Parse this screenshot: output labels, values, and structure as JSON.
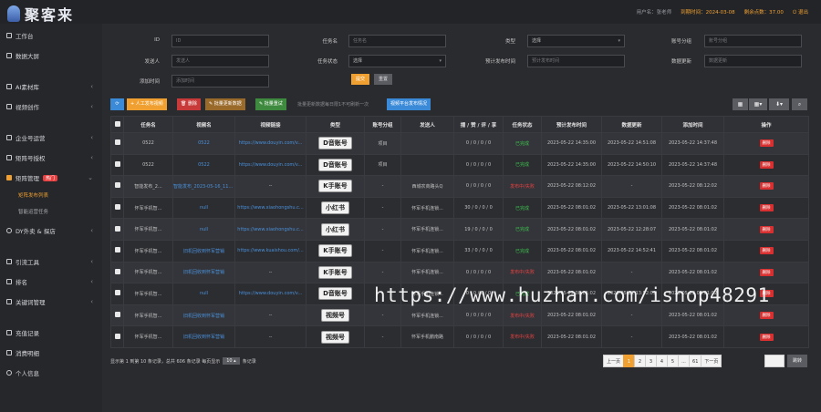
{
  "header": {
    "logo_text": "聚客来",
    "user": "用户名：张老师",
    "expire": "到期时间：2024-03-08",
    "points": "剩余点数：37.00",
    "logout": "退出"
  },
  "sidebar": {
    "items": [
      {
        "label": "工作台",
        "chev": ""
      },
      {
        "label": "数据大屏",
        "chev": ""
      },
      {
        "label": "AI素材库",
        "chev": "‹"
      },
      {
        "label": "视频创作",
        "chev": "‹"
      },
      {
        "label": "企业号运营",
        "chev": "‹"
      },
      {
        "label": "矩阵号授权",
        "chev": "‹"
      },
      {
        "label": "矩阵管理",
        "chev": "⌄",
        "badge": "热门"
      },
      {
        "label": "DY外卖 & 探店",
        "chev": "‹"
      },
      {
        "label": "引流工具",
        "chev": "‹"
      },
      {
        "label": "排名",
        "chev": "‹"
      },
      {
        "label": "关键词管理",
        "chev": "‹"
      },
      {
        "label": "充值记录",
        "chev": ""
      },
      {
        "label": "消费明细",
        "chev": ""
      },
      {
        "label": "个人信息",
        "chev": ""
      }
    ],
    "subitems": [
      "矩阵发布列表",
      "智能运营任务"
    ]
  },
  "filters": {
    "id_label": "ID",
    "id_ph": "ID",
    "taskname_label": "任务名",
    "taskname_ph": "任务名",
    "type_label": "类型",
    "type_value": "选择",
    "account_group_label": "账号分组",
    "account_group_ph": "账号分组",
    "publisher_label": "发送人",
    "publisher_ph": "发送人",
    "task_status_label": "任务状态",
    "task_status_value": "选择",
    "plan_time_label": "预计发布时间",
    "plan_time_ph": "预计发布时间",
    "data_update_label": "数据更新",
    "data_update_ph": "数据更新",
    "add_time_label": "添加时间",
    "add_time_ph": "添加时间",
    "submit": "提交",
    "reset": "重置"
  },
  "toolbar": {
    "refresh": "⟳",
    "manual_publish": "+ 人工发布视频",
    "delete": "删除",
    "batch_update": "批量更新数据",
    "batch_edit": "批量重试",
    "note": "批量更新数据每日限1不可刷新一次",
    "platform_btn": "视频平台发布情况"
  },
  "table": {
    "headers": [
      "",
      "任务名",
      "视频名",
      "视频链接",
      "类型",
      "账号分组",
      "发送人",
      "播 / 赞 / 评 / 享",
      "任务状态",
      "预计发布时间",
      "数据更新",
      "添加时间",
      "操作"
    ],
    "rows": [
      {
        "task": "0522",
        "video": "0522",
        "url": "https://www.douyin.com/v...",
        "type": "D音账号",
        "group": "项目",
        "sender": "",
        "stats": "0 / 0 / 0 / 0",
        "status": "已完成",
        "status_color": "green",
        "plan": "2023-05-22 14:35:00",
        "update": "2023-05-22 14:51:08",
        "added": "2023-05-22 14:37:48",
        "op": "删除"
      },
      {
        "task": "0522",
        "video": "0522",
        "url": "https://www.douyin.com/v...",
        "type": "D音账号",
        "group": "项目",
        "sender": "",
        "stats": "0 / 0 / 0 / 0",
        "status": "已完成",
        "status_color": "green",
        "plan": "2023-05-22 14:35:00",
        "update": "2023-05-22 14:50:10",
        "added": "2023-05-22 14:37:48",
        "op": "删除"
      },
      {
        "task": "智能发布_2...",
        "video": "智能发布_2023-05-16_11:20",
        "url": "--",
        "type": "K手账号",
        "group": "-",
        "sender": "西城农商路头Q",
        "stats": "0 / 0 / 0 / 0",
        "status": "发布中/失败",
        "status_color": "red",
        "plan": "2023-05-22 08:12:02",
        "update": "-",
        "added": "2023-05-22 08:12:02",
        "op": "删除"
      },
      {
        "task": "怀军手机智...",
        "video": "null",
        "url": "https://www.xiaohongshu.c...",
        "type": "小红书",
        "group": "-",
        "sender": "怀军手机连锁...",
        "stats": "30 / 0 / 0 / 0",
        "status": "已完成",
        "status_color": "green",
        "plan": "2023-05-22 08:01:02",
        "update": "2023-05-22 13:01:08",
        "added": "2023-05-22 08:01:02",
        "op": "删除"
      },
      {
        "task": "怀军手机智...",
        "video": "null",
        "url": "https://www.xiaohongshu.c...",
        "type": "小红书",
        "group": "-",
        "sender": "怀军手机连锁...",
        "stats": "19 / 0 / 0 / 0",
        "status": "已完成",
        "status_color": "green",
        "plan": "2023-05-22 08:01:02",
        "update": "2023-05-22 12:28:07",
        "added": "2023-05-22 08:01:02",
        "op": "删除"
      },
      {
        "task": "怀军手机智...",
        "video": "旧机回收到怀军营销",
        "url": "https://www.kuaishou.com/...",
        "type": "K手账号",
        "group": "-",
        "sender": "怀军手机连锁...",
        "stats": "33 / 0 / 0 / 0",
        "status": "已完成",
        "status_color": "green",
        "plan": "2023-05-22 08:01:02",
        "update": "2023-05-22 14:52:41",
        "added": "2023-05-22 08:01:02",
        "op": "删除"
      },
      {
        "task": "怀军手机智...",
        "video": "旧机回收到怀军营销",
        "url": "--",
        "type": "K手账号",
        "group": "-",
        "sender": "怀军手机连锁...",
        "stats": "0 / 0 / 0 / 0",
        "status": "发布中/失败",
        "status_color": "red",
        "plan": "2023-05-22 08:01:02",
        "update": "-",
        "added": "2023-05-22 08:01:02",
        "op": "删除"
      },
      {
        "task": "怀军手机智...",
        "video": "null",
        "url": "https://www.douyin.com/v...",
        "type": "D音账号",
        "group": "-",
        "sender": "怀军手机连锁...",
        "stats": "0 / 0 / 0 / 0",
        "status": "已完成",
        "status_color": "green",
        "plan": "2023-05-22 08:01:02",
        "update": "2023-05-22 13:52:09",
        "added": "2023-05-22 08:01:02",
        "op": "删除"
      },
      {
        "task": "怀军手机智...",
        "video": "旧机回收到怀军营销",
        "url": "--",
        "type": "视频号",
        "group": "-",
        "sender": "怀军手机连锁...",
        "stats": "0 / 0 / 0 / 0",
        "status": "发布中/失败",
        "status_color": "red",
        "plan": "2023-05-22 08:01:02",
        "update": "-",
        "added": "2023-05-22 08:01:02",
        "op": "删除"
      },
      {
        "task": "怀军手机智...",
        "video": "旧机回收到怀军营销",
        "url": "--",
        "type": "视频号",
        "group": "-",
        "sender": "怀军手机鹏南路",
        "stats": "0 / 0 / 0 / 0",
        "status": "发布中/失败",
        "status_color": "red",
        "plan": "2023-05-22 08:01:02",
        "update": "-",
        "added": "2023-05-22 08:01:02",
        "op": "删除"
      }
    ]
  },
  "footer": {
    "summary": "显示第 1 到第 10 条记录，总共 606 条记录 每页显示",
    "per_page": "10 ▴",
    "suffix": "条记录"
  },
  "pager": {
    "prev": "上一页",
    "pages": [
      "1",
      "2",
      "3",
      "4",
      "5",
      "...",
      "61"
    ],
    "next": "下一页",
    "jump": "跳转"
  },
  "watermark": "https://www.huzhan.com/ishop48291",
  "colors": {
    "accent": "#f0a030",
    "link": "#4a90d9",
    "danger": "#d83030",
    "success": "#3cc04c"
  }
}
